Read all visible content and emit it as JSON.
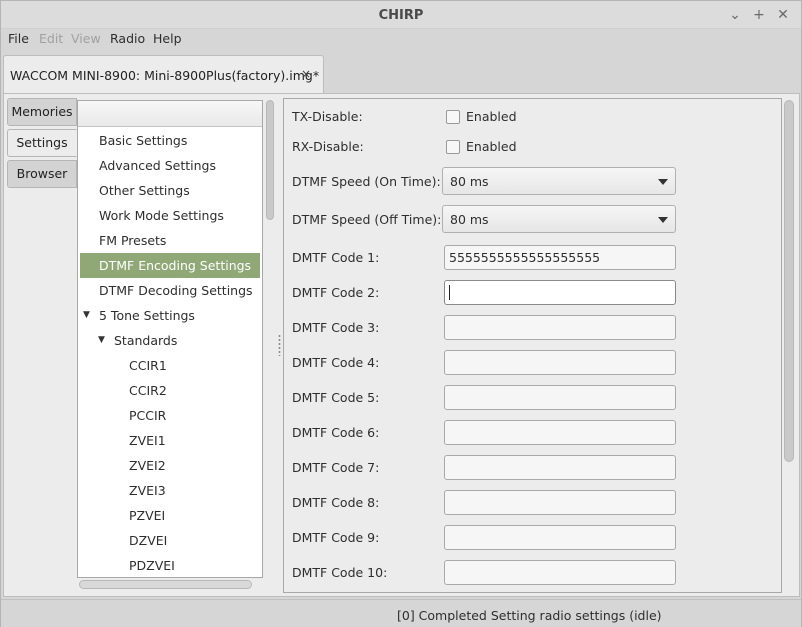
{
  "window": {
    "title": "CHIRP"
  },
  "menu": [
    "File",
    "Edit",
    "View",
    "Radio",
    "Help"
  ],
  "doc_tab": {
    "label": "WACCOM MINI-8900: Mini-8900Plus(factory).img*",
    "close": "×"
  },
  "side_tabs": [
    "Memories",
    "Settings",
    "Browser"
  ],
  "tree": {
    "items": [
      {
        "label": "Basic Settings"
      },
      {
        "label": "Advanced Settings"
      },
      {
        "label": "Other Settings"
      },
      {
        "label": "Work Mode Settings"
      },
      {
        "label": "FM Presets"
      },
      {
        "label": "DTMF Encoding Settings"
      },
      {
        "label": "DTMF Decoding Settings"
      },
      {
        "label": "5 Tone Settings"
      },
      {
        "label": "Standards"
      },
      {
        "label": "CCIR1"
      },
      {
        "label": "CCIR2"
      },
      {
        "label": "PCCIR"
      },
      {
        "label": "ZVEI1"
      },
      {
        "label": "ZVEI2"
      },
      {
        "label": "ZVEI3"
      },
      {
        "label": "PZVEI"
      },
      {
        "label": "DZVEI"
      },
      {
        "label": "PDZVEI"
      }
    ],
    "selected": "DTMF Encoding Settings"
  },
  "settings": {
    "tx_disable": {
      "label": "TX-Disable:",
      "check_label": "Enabled",
      "checked": false
    },
    "rx_disable": {
      "label": "RX-Disable:",
      "check_label": "Enabled",
      "checked": false
    },
    "dtmf_on": {
      "label": "DTMF Speed (On Time):",
      "value": "80 ms"
    },
    "dtmf_off": {
      "label": "DTMF Speed (Off Time):",
      "value": "80 ms"
    },
    "codes": [
      {
        "label": "DMTF Code 1:",
        "value": "5555555555555555555"
      },
      {
        "label": "DMTF Code 2:",
        "value": ""
      },
      {
        "label": "DMTF Code 3:",
        "value": ""
      },
      {
        "label": "DMTF Code 4:",
        "value": ""
      },
      {
        "label": "DMTF Code 5:",
        "value": ""
      },
      {
        "label": "DMTF Code 6:",
        "value": ""
      },
      {
        "label": "DMTF Code 7:",
        "value": ""
      },
      {
        "label": "DMTF Code 8:",
        "value": ""
      },
      {
        "label": "DMTF Code 9:",
        "value": ""
      },
      {
        "label": "DMTF Code 10:",
        "value": ""
      }
    ]
  },
  "status": {
    "text": "[0] Completed Setting radio settings (idle)"
  },
  "icons": {
    "minimize": "minimize-icon",
    "maximize": "maximize-icon",
    "close": "close-icon",
    "expander": "expander-down-icon"
  },
  "colors": {
    "selection": "#8fa876"
  }
}
